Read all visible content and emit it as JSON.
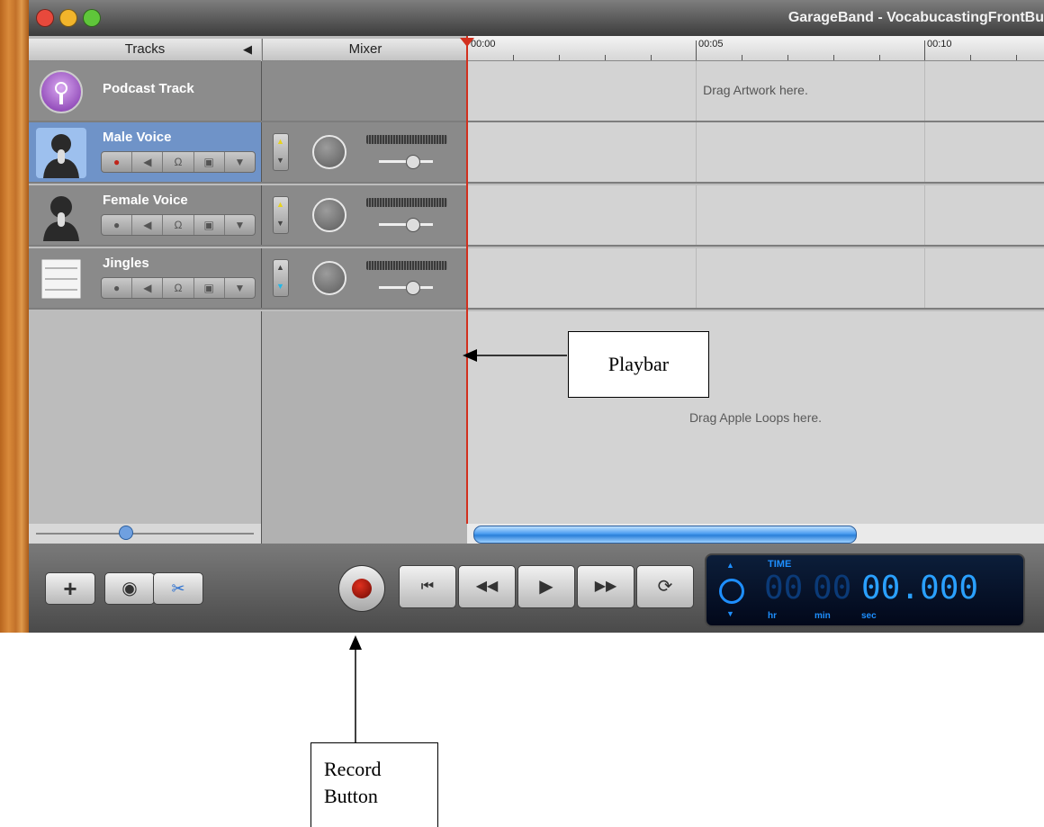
{
  "window": {
    "title": "GarageBand - VocabucastingFrontBu",
    "traffic_lights": {
      "close_color": "#e8493c",
      "minimize_color": "#f2b52b",
      "zoom_color": "#5fc63a"
    }
  },
  "columns": {
    "tracks_label": "Tracks",
    "mixer_label": "Mixer"
  },
  "ruler": {
    "labels": [
      "00:00",
      "00:05",
      "00:10"
    ]
  },
  "podcast_track": {
    "name": "Podcast Track",
    "lane_hint": "Drag Artwork here."
  },
  "tracks": [
    {
      "name": "Male Voice",
      "selected": true,
      "icon": "male-voice-icon"
    },
    {
      "name": "Female Voice",
      "selected": false,
      "icon": "female-voice-icon"
    },
    {
      "name": "Jingles",
      "selected": false,
      "icon": "sheet-music-icon"
    }
  ],
  "loops_hint": "Drag Apple Loops here.",
  "transport": {
    "record_icon": "record-icon",
    "buttons": [
      "go-to-beginning-icon",
      "rewind-icon",
      "play-icon",
      "fast-forward-icon",
      "cycle-icon"
    ]
  },
  "lcd": {
    "mode_label": "TIME",
    "hr": "00",
    "min": "00",
    "sec": "00.000",
    "hr_label": "hr",
    "min_label": "min",
    "sec_label": "sec",
    "accent_color": "#1e8fff"
  },
  "annotations": {
    "playbar": "Playbar",
    "record_button": "Record Button"
  },
  "colors": {
    "selected_track": "#6f93c8",
    "track_header": "#8a8a8a",
    "playhead": "#d2301e"
  }
}
